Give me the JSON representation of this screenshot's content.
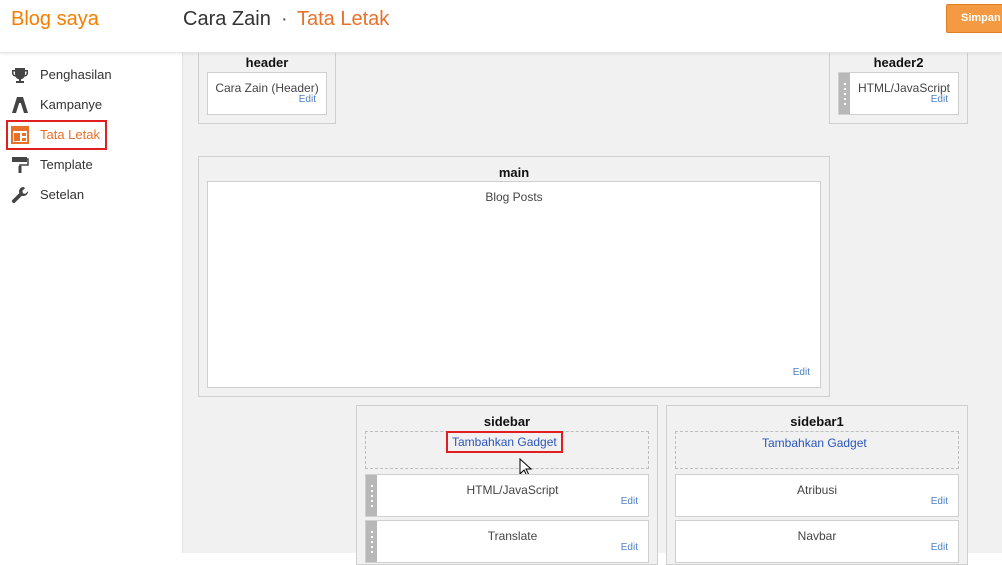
{
  "header": {
    "brand": "Blog saya",
    "blog_name": "Cara Zain",
    "separator": "·",
    "page_name": "Tata Letak",
    "save_label": "Simpan"
  },
  "nav": {
    "items": [
      {
        "label": "Penghasilan",
        "icon": "trophy-icon"
      },
      {
        "label": "Kampanye",
        "icon": "campaign-icon"
      },
      {
        "label": "Tata Letak",
        "icon": "layout-icon",
        "active": true
      },
      {
        "label": "Template",
        "icon": "paint-roller-icon"
      },
      {
        "label": "Setelan",
        "icon": "wrench-icon"
      }
    ]
  },
  "layout": {
    "edit_label": "Edit",
    "add_gadget_label": "Tambahkan Gadget",
    "header": {
      "title": "header",
      "widget": "Cara Zain (Header)"
    },
    "header2": {
      "title": "header2",
      "widget": "HTML/JavaScript"
    },
    "main": {
      "title": "main",
      "widget": "Blog Posts"
    },
    "sidebar": {
      "title": "sidebar",
      "widgets": [
        "HTML/JavaScript",
        "Translate"
      ]
    },
    "sidebar1": {
      "title": "sidebar1",
      "widgets": [
        "Atribusi",
        "Navbar"
      ]
    }
  },
  "colors": {
    "accent": "#f57d00",
    "link": "#2a56b8",
    "highlight_box": "#e02020"
  }
}
